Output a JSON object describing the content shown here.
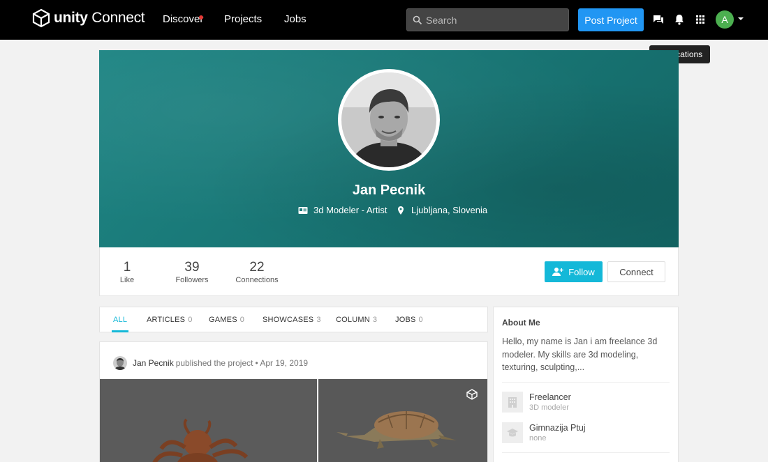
{
  "nav": {
    "brand_bold": "unity",
    "brand_rest": " Connect",
    "links": [
      "Discover",
      "Projects",
      "Jobs"
    ],
    "search_placeholder": "Search",
    "post_project": "Post Project",
    "avatar_letter": "A",
    "tooltip": "Notifications"
  },
  "profile": {
    "name": "Jan Pecnik",
    "title": "3d Modeler - Artist",
    "location": "Ljubljana, Slovenia"
  },
  "stats": [
    {
      "value": "1",
      "label": "Like"
    },
    {
      "value": "39",
      "label": "Followers"
    },
    {
      "value": "22",
      "label": "Connections"
    }
  ],
  "actions": {
    "follow": "Follow",
    "connect": "Connect"
  },
  "tabs": [
    {
      "label": "ALL",
      "count": ""
    },
    {
      "label": "ARTICLES",
      "count": "0"
    },
    {
      "label": "GAMES",
      "count": "0"
    },
    {
      "label": "SHOWCASES",
      "count": "3"
    },
    {
      "label": "COLUMN",
      "count": "3"
    },
    {
      "label": "JOBS",
      "count": "0"
    }
  ],
  "post": {
    "author": "Jan Pecnik",
    "action": "published the project",
    "date": "• Apr 19, 2019"
  },
  "about": {
    "heading": "About Me",
    "bio": "Hello, my name is Jan i am freelance 3d modeler. My skills are 3d modeling, texturing, sculpting,...",
    "items": [
      {
        "title": "Freelancer",
        "subtitle": "3D modeler",
        "icon": "building-icon"
      },
      {
        "title": "Gimnazija Ptuj",
        "subtitle": "none",
        "icon": "graduation-cap-icon"
      }
    ]
  },
  "colors": {
    "accent": "#14b8d8",
    "post_button": "#2196f3",
    "cover": "#1a7a79"
  }
}
